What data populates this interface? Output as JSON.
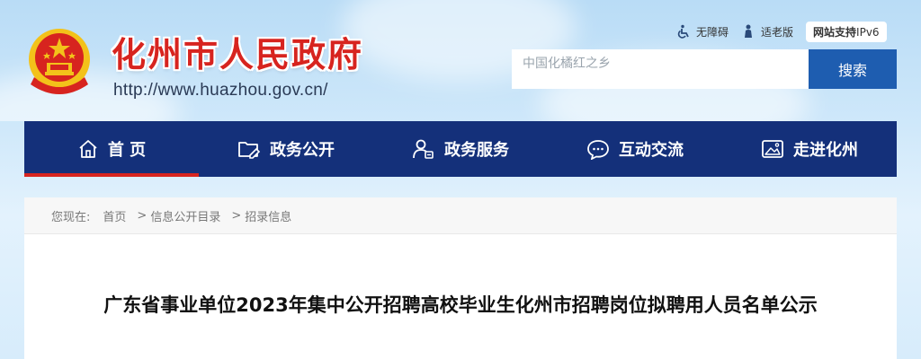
{
  "site": {
    "title": "化州市人民政府",
    "url": "http://www.huazhou.gov.cn/"
  },
  "toplinks": {
    "accessibility": "无障碍",
    "elderly": "适老版",
    "ipv6_bold": "网站支持",
    "ipv6_rest": "IPv6"
  },
  "search": {
    "placeholder": "中国化橘红之乡",
    "button": "搜索"
  },
  "nav": [
    {
      "label": "首 页",
      "icon": "home-icon"
    },
    {
      "label": "政务公开",
      "icon": "folder-icon"
    },
    {
      "label": "政务服务",
      "icon": "user-service-icon"
    },
    {
      "label": "互动交流",
      "icon": "chat-icon"
    },
    {
      "label": "走进化州",
      "icon": "picture-icon"
    }
  ],
  "breadcrumb": {
    "prefix": "您现在:",
    "items": [
      "首页",
      "信息公开目录",
      "招录信息"
    ],
    "separator": ">"
  },
  "article": {
    "title": "广东省事业单位2023年集中公开招聘高校毕业生化州市招聘岗位拟聘用人员名单公示"
  },
  "colors": {
    "nav_bg": "#14307a",
    "active_underline": "#d7241f",
    "title_red": "#d7241f",
    "search_button": "#1e5db0"
  }
}
